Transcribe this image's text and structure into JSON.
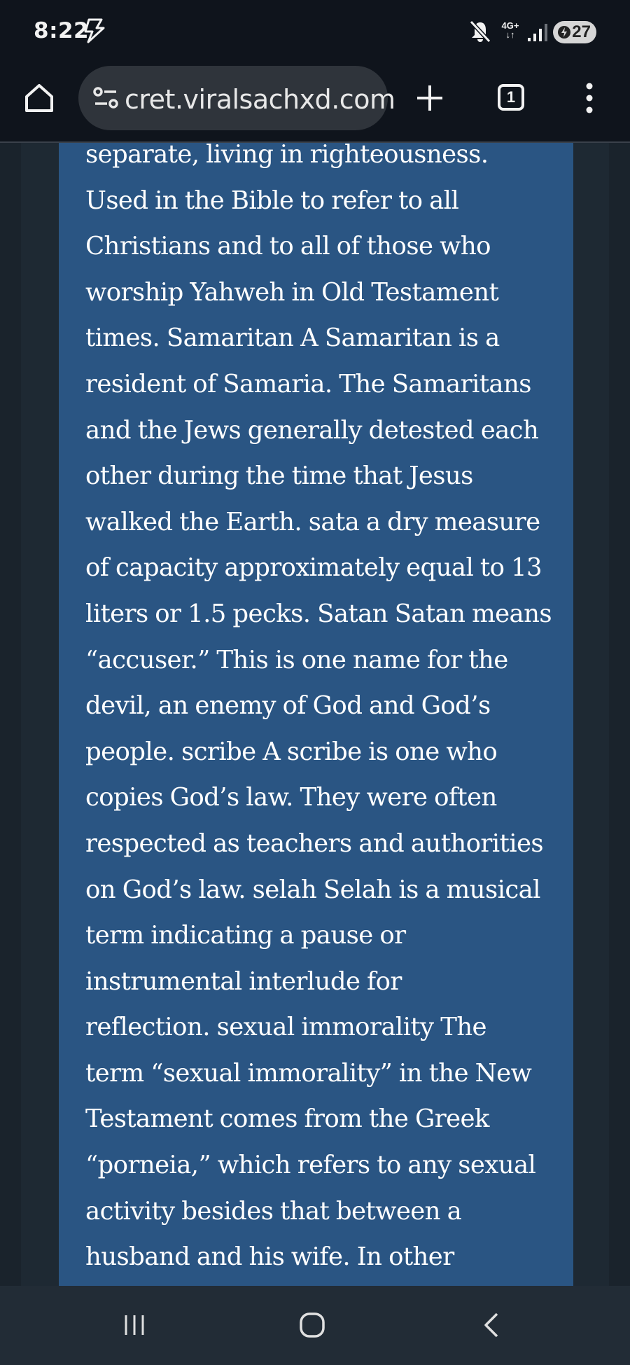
{
  "status_bar": {
    "time": "8:22",
    "network_type_top": "4G+",
    "network_type_bottom": "↓↑",
    "battery_level": "27",
    "icons": [
      "flash-icon",
      "mute-icon",
      "signal-icon",
      "battery-saver-icon"
    ]
  },
  "browser": {
    "url_display": "cret.viralsachxd.com",
    "tab_count": "1",
    "icons": [
      "home-icon",
      "tune-icon",
      "plus-icon",
      "tabs-icon",
      "more-vert-icon"
    ]
  },
  "colors": {
    "card_background": "#2a5583",
    "page_background": "#1e2933",
    "text": "#ffffff",
    "chrome_background": "#0f141c"
  },
  "article": {
    "lines": [
      "separate, living in righteousness.",
      "Used in the Bible to refer to all",
      "Christians and to all of those who",
      "worship Yahweh in Old Testament",
      "times. Samaritan A Samaritan is a",
      "resident of Samaria. The Samaritans",
      "and the Jews generally detested each",
      "other during the time that Jesus",
      "walked the Earth. sata a dry measure",
      "of capacity approximately equal to 13",
      "liters or 1.5 pecks. Satan Satan means",
      "“accuser.” This is one name for the",
      "devil, an enemy of God and God’s",
      "people. scribe A scribe is one who",
      "copies God’s law. They were often",
      "respected as teachers and authorities",
      "on God’s law. selah Selah is a musical",
      "term indicating a pause or",
      "instrumental interlude for",
      "reflection. sexual immorality The",
      "term “sexual immorality” in the New",
      "Testament comes from the Greek",
      "“porneia,” which refers to any sexual",
      "activity besides that between a",
      "husband and his wife. In other"
    ]
  },
  "nav_bar": {
    "icons": [
      "recent-apps-icon",
      "home-circle-icon",
      "back-icon"
    ]
  }
}
